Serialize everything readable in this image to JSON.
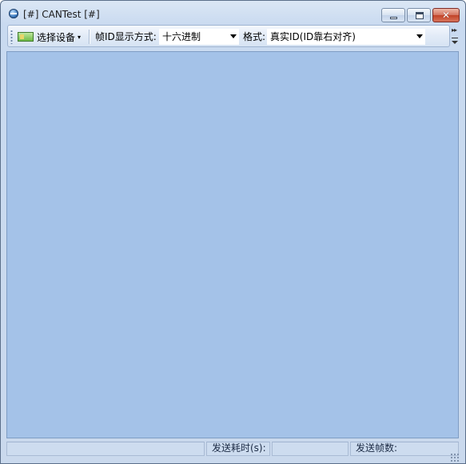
{
  "window": {
    "title": "[#] CANTest [#]",
    "controls": {
      "close_glyph": "✕"
    }
  },
  "toolbar": {
    "device_label": "选择设备",
    "device_caret": "▾",
    "frame_id_label": "帧ID显示方式:",
    "frame_id_value": "十六进制",
    "format_label": "格式:",
    "format_value": "真实ID(ID靠右对齐)"
  },
  "statusbar": {
    "send_time_label": "发送耗时(s):",
    "send_frames_label": "发送帧数:"
  },
  "colors": {
    "workspace": "#a4c2e8",
    "chrome": "#cad9ed"
  }
}
